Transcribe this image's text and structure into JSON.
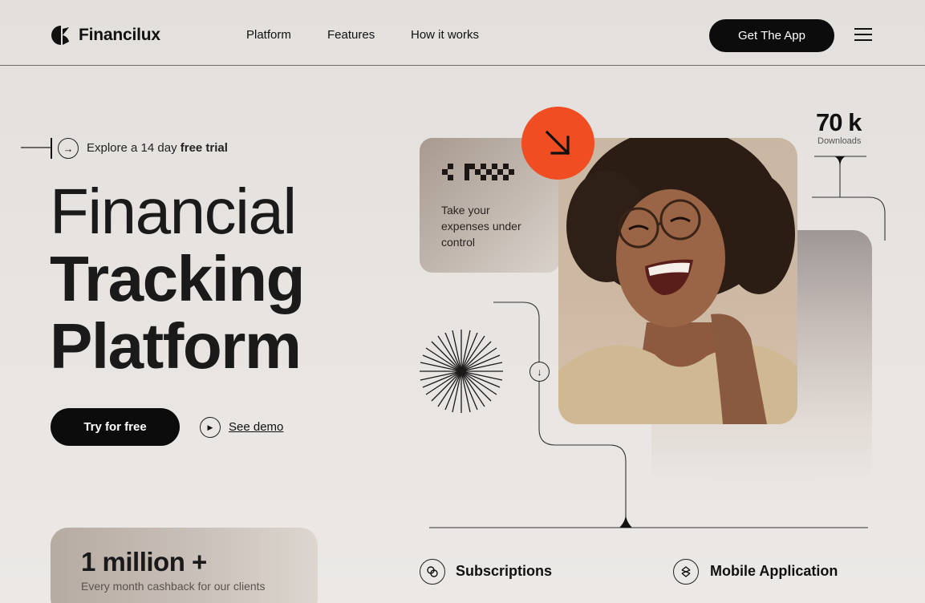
{
  "brand": {
    "name": "Financilux"
  },
  "nav": {
    "links": [
      "Platform",
      "Features",
      "How it works"
    ],
    "cta_label": "Get The App"
  },
  "hero": {
    "trial_prefix": "Explore a 14 day ",
    "trial_bold": "free trial",
    "title_line1": "Financial",
    "title_line2": "Tracking",
    "title_line3": "Platform",
    "primary_cta": "Try for free",
    "secondary_cta": "See demo"
  },
  "stat_card": {
    "value": "1 million +",
    "caption": "Every month cashback for our clients"
  },
  "expense_card": {
    "text": "Take your expenses under control"
  },
  "downloads": {
    "value": "70 k",
    "label": "Downloads"
  },
  "features": [
    {
      "label": "Subscriptions",
      "icon": "link-icon"
    },
    {
      "label": "Mobile Application",
      "icon": "layers-icon"
    }
  ],
  "colors": {
    "accent": "#f04d22",
    "dark": "#0c0c0c",
    "background": "#e5e1de"
  }
}
